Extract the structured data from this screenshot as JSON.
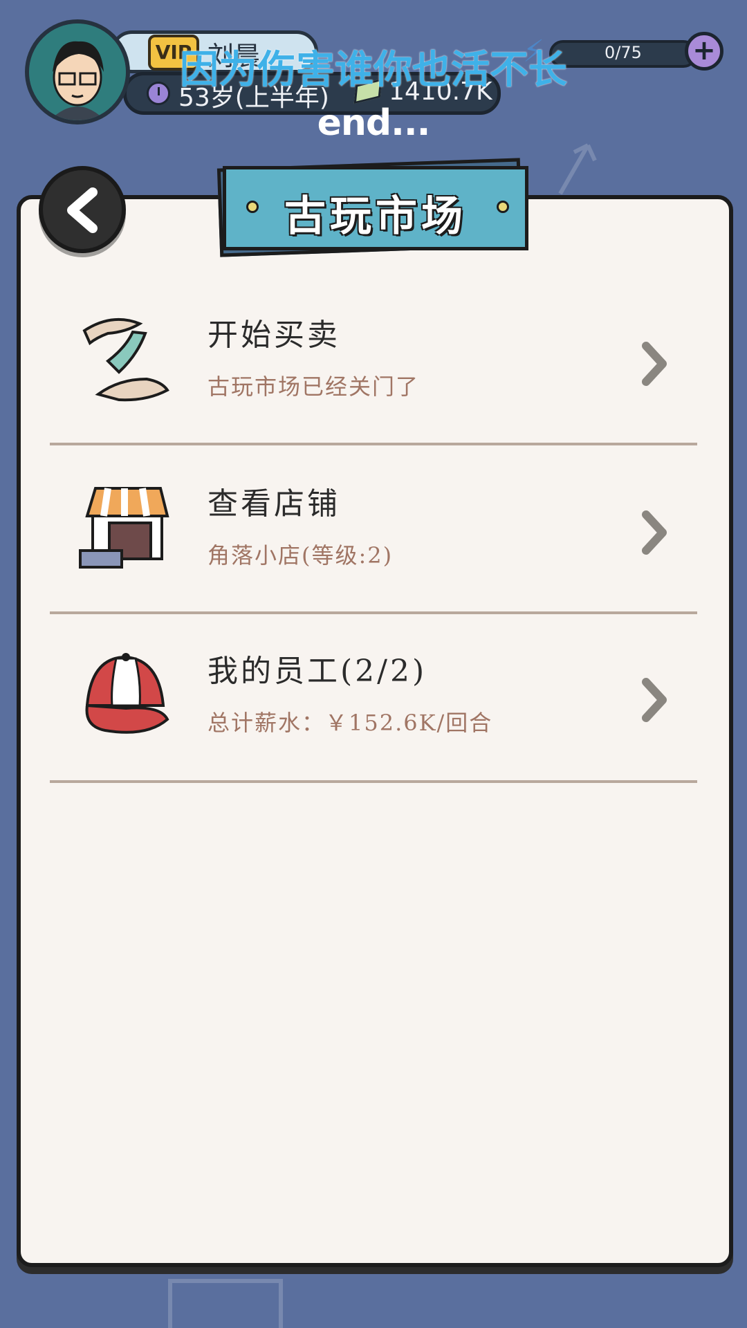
{
  "hud": {
    "vip_label": "VIP",
    "player_name": "刘晨",
    "age": "53岁(上半年)",
    "cash": "1410.7K",
    "energy": "0/75",
    "plus_symbol": "+"
  },
  "overlay": {
    "subtitle": "因为伤害谁你也活不长",
    "end_text": "end..."
  },
  "panel": {
    "title": "古玩市场",
    "items": [
      {
        "label": "开始买卖",
        "sub": "古玩市场已经关门了",
        "icon": "handshake-icon"
      },
      {
        "label": "查看店铺",
        "sub": "角落小店(等级:2)",
        "icon": "shop-icon"
      },
      {
        "label": "我的员工(2/2)",
        "sub": "总计薪水：￥152.6K/回合",
        "icon": "cap-icon"
      }
    ]
  },
  "colors": {
    "background": "#5a6f9e",
    "panel": "#f8f4f0",
    "title_plate": "#5fb3c8",
    "subtext": "#a07564",
    "subtitle": "#3fb1e8"
  }
}
